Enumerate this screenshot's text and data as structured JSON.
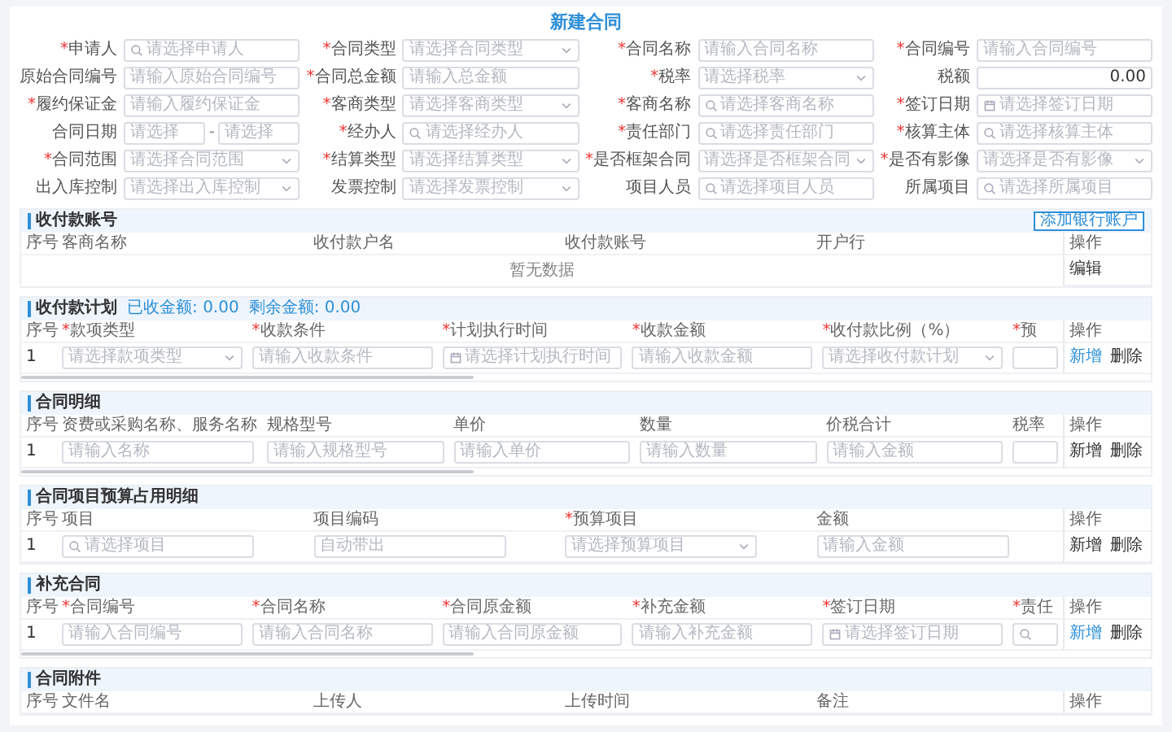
{
  "title": "新建合同",
  "form": [
    {
      "mark": "*",
      "label": "申请人",
      "field": {
        "kind": "search",
        "placeholder": "请选择申请人"
      }
    },
    {
      "mark": "*",
      "label": "合同类型",
      "field": {
        "kind": "select",
        "placeholder": "请选择合同类型"
      }
    },
    {
      "mark": "*",
      "label": "合同名称",
      "field": {
        "kind": "input",
        "placeholder": "请输入合同名称"
      }
    },
    {
      "mark": "*",
      "label": "合同编号",
      "field": {
        "kind": "input",
        "placeholder": "请输入合同编号"
      }
    },
    {
      "label": "原始合同编号",
      "field": {
        "kind": "input",
        "placeholder": "请输入原始合同编号"
      }
    },
    {
      "mark": "*",
      "label": "合同总金额",
      "field": {
        "kind": "input",
        "placeholder": "请输入总金额"
      }
    },
    {
      "mark": "*",
      "label": "税率",
      "field": {
        "kind": "select",
        "placeholder": "请选择税率"
      }
    },
    {
      "label": "税额",
      "field": {
        "kind": "value",
        "value": "0.00"
      }
    },
    {
      "mark": "*",
      "label": "履约保证金",
      "field": {
        "kind": "input",
        "placeholder": "请输入履约保证金"
      }
    },
    {
      "mark": "*",
      "label": "客商类型",
      "field": {
        "kind": "select",
        "placeholder": "请选择客商类型"
      }
    },
    {
      "mark": "*",
      "label": "客商名称",
      "field": {
        "kind": "search",
        "placeholder": "请选择客商名称"
      }
    },
    {
      "mark": "*",
      "label": "签订日期",
      "field": {
        "kind": "date",
        "placeholder": "请选择签订日期"
      }
    },
    {
      "label": "合同日期",
      "field": {
        "kind": "range",
        "from": "请选择",
        "separator": "-",
        "to": "请选择"
      }
    },
    {
      "mark": "*",
      "label": "经办人",
      "field": {
        "kind": "search",
        "placeholder": "请选择经办人"
      }
    },
    {
      "mark": "*",
      "label": "责任部门",
      "field": {
        "kind": "search",
        "placeholder": "请选择责任部门"
      }
    },
    {
      "mark": "*",
      "label": "核算主体",
      "field": {
        "kind": "search",
        "placeholder": "请选择核算主体"
      }
    },
    {
      "mark": "*",
      "label": "合同范围",
      "field": {
        "kind": "select",
        "placeholder": "请选择合同范围"
      }
    },
    {
      "mark": "*",
      "label": "结算类型",
      "field": {
        "kind": "select",
        "placeholder": "请选择结算类型"
      }
    },
    {
      "mark": "*",
      "label": "是否框架合同",
      "field": {
        "kind": "select",
        "placeholder": "请选择是否框架合同"
      }
    },
    {
      "mark": "*",
      "label": "是否有影像",
      "field": {
        "kind": "select",
        "placeholder": "请选择是否有影像"
      }
    },
    {
      "label": "出入库控制",
      "field": {
        "kind": "select",
        "placeholder": "请选择出入库控制"
      }
    },
    {
      "label": "发票控制",
      "field": {
        "kind": "select",
        "placeholder": "请选择发票控制"
      }
    },
    {
      "label": "项目人员",
      "field": {
        "kind": "search",
        "placeholder": "请选择项目人员"
      }
    },
    {
      "label": "所属项目",
      "field": {
        "kind": "search",
        "placeholder": "请选择所属项目"
      }
    }
  ],
  "sections": [
    {
      "title": "收付款账号",
      "button": "添加银行账户",
      "columns": [
        {
          "label": "客商名称"
        },
        {
          "label": "收付款户名"
        },
        {
          "label": "收付款账号"
        },
        {
          "label": "开户行"
        }
      ],
      "seq_header": "序号",
      "action_header": "操作",
      "empty": {
        "text": "暂无数据",
        "action": "编辑"
      }
    },
    {
      "title": "收付款计划",
      "summary": [
        {
          "label": "已收金额:",
          "value": "0.00"
        },
        {
          "label": "剩余金额:",
          "value": "0.00"
        }
      ],
      "seq_header": "序号",
      "action_header": "操作",
      "scrollable": true,
      "columns": [
        {
          "mark": "*",
          "label": "款项类型"
        },
        {
          "mark": "*",
          "label": "收款条件"
        },
        {
          "mark": "*",
          "label": "计划执行时间"
        },
        {
          "mark": "*",
          "label": "收款金额"
        },
        {
          "mark": "*",
          "label": "收付款比例（%）"
        },
        {
          "mark": "*",
          "label": "预",
          "cut": true
        }
      ],
      "rows": [
        {
          "seq": "1",
          "cells": [
            {
              "kind": "select",
              "placeholder": "请选择款项类型"
            },
            {
              "kind": "input",
              "placeholder": "请输入收款条件"
            },
            {
              "kind": "date",
              "placeholder": "请选择计划执行时间"
            },
            {
              "kind": "input",
              "placeholder": "请输入收款金额"
            },
            {
              "kind": "select",
              "placeholder": "请选择收付款计划"
            },
            {
              "kind": "input"
            }
          ],
          "actions": [
            {
              "label": "新增",
              "highlighted": true
            },
            {
              "label": "删除",
              "highlighted": false
            }
          ]
        }
      ]
    },
    {
      "title": "合同明细",
      "seq_header": "序号",
      "action_header": "操作",
      "scrollable": true,
      "columns": [
        {
          "label": "资费或采购名称、服务名称"
        },
        {
          "label": "规格型号"
        },
        {
          "label": "单价"
        },
        {
          "label": "数量"
        },
        {
          "label": "价税合计"
        },
        {
          "label": "税率",
          "cut": true
        }
      ],
      "rows": [
        {
          "seq": "1",
          "cells": [
            {
              "kind": "input",
              "placeholder": "请输入名称"
            },
            {
              "kind": "input",
              "placeholder": "请输入规格型号"
            },
            {
              "kind": "input",
              "placeholder": "请输入单价"
            },
            {
              "kind": "input",
              "placeholder": "请输入数量"
            },
            {
              "kind": "input",
              "placeholder": "请输入金额"
            },
            {
              "kind": "input"
            }
          ],
          "actions": [
            {
              "label": "新增",
              "highlighted": false
            },
            {
              "label": "删除",
              "highlighted": false
            }
          ]
        }
      ]
    },
    {
      "title": "合同项目预算占用明细",
      "seq_header": "序号",
      "action_header": "操作",
      "scrollable": false,
      "columns": [
        {
          "label": "项目"
        },
        {
          "label": "项目编码"
        },
        {
          "mark": "*",
          "label": "预算项目"
        },
        {
          "label": "金额"
        }
      ],
      "rows": [
        {
          "seq": "1",
          "cells": [
            {
              "kind": "search",
              "placeholder": "请选择项目"
            },
            {
              "kind": "input",
              "placeholder": "自动带出"
            },
            {
              "kind": "select",
              "placeholder": "请选择预算项目"
            },
            {
              "kind": "input",
              "placeholder": "请输入金额"
            }
          ],
          "actions": [
            {
              "label": "新增",
              "highlighted": false
            },
            {
              "label": "删除",
              "highlighted": false
            }
          ]
        }
      ]
    },
    {
      "title": "补充合同",
      "seq_header": "序号",
      "action_header": "操作",
      "scrollable": true,
      "columns": [
        {
          "mark": "*",
          "label": "合同编号"
        },
        {
          "mark": "*",
          "label": "合同名称"
        },
        {
          "mark": "*",
          "label": "合同原金额"
        },
        {
          "mark": "*",
          "label": "补充金额"
        },
        {
          "mark": "*",
          "label": "签订日期"
        },
        {
          "mark": "*",
          "label": "责任",
          "cut": true
        }
      ],
      "rows": [
        {
          "seq": "1",
          "cells": [
            {
              "kind": "input",
              "placeholder": "请输入合同编号"
            },
            {
              "kind": "input",
              "placeholder": "请输入合同名称"
            },
            {
              "kind": "input",
              "placeholder": "请输入合同原金额"
            },
            {
              "kind": "input",
              "placeholder": "请输入补充金额"
            },
            {
              "kind": "date",
              "placeholder": "请选择签订日期"
            },
            {
              "kind": "search"
            }
          ],
          "actions": [
            {
              "label": "新增",
              "highlighted": true
            },
            {
              "label": "删除",
              "highlighted": false
            }
          ]
        }
      ]
    },
    {
      "title": "合同附件",
      "seq_header": "序号",
      "action_header": "操作",
      "columns": [
        {
          "label": "文件名"
        },
        {
          "label": "上传人"
        },
        {
          "label": "上传时间"
        },
        {
          "label": "备注"
        }
      ]
    }
  ]
}
